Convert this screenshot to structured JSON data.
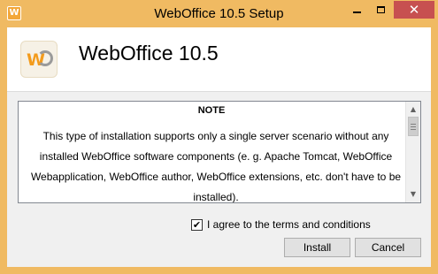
{
  "window": {
    "title": "WebOffice 10.5 Setup",
    "app_icon": "webfoffice-app-icon",
    "controls": {
      "minimize": "minimize-icon",
      "maximize": "maximize-icon",
      "close_glyph": "✕"
    },
    "colors": {
      "frame": "#f0ba62",
      "close": "#c75050"
    }
  },
  "header": {
    "logo_icon": "weboffice-logo-icon",
    "logo_letter": "W",
    "heading": "WebOffice 10.5"
  },
  "notice": {
    "title": "NOTE",
    "body": "This type of installation supports only a single server scenario without any installed WebOffice software components (e. g. Apache Tomcat, WebOffice Webapplication, WebOffice author, WebOffice extensions, etc. don't have to be installed).",
    "scroll_up": "▲",
    "scroll_down": "▼"
  },
  "agree": {
    "checked": true,
    "check_glyph": "✔",
    "label": "I agree to the terms and conditions"
  },
  "buttons": {
    "install": "Install",
    "cancel": "Cancel"
  }
}
